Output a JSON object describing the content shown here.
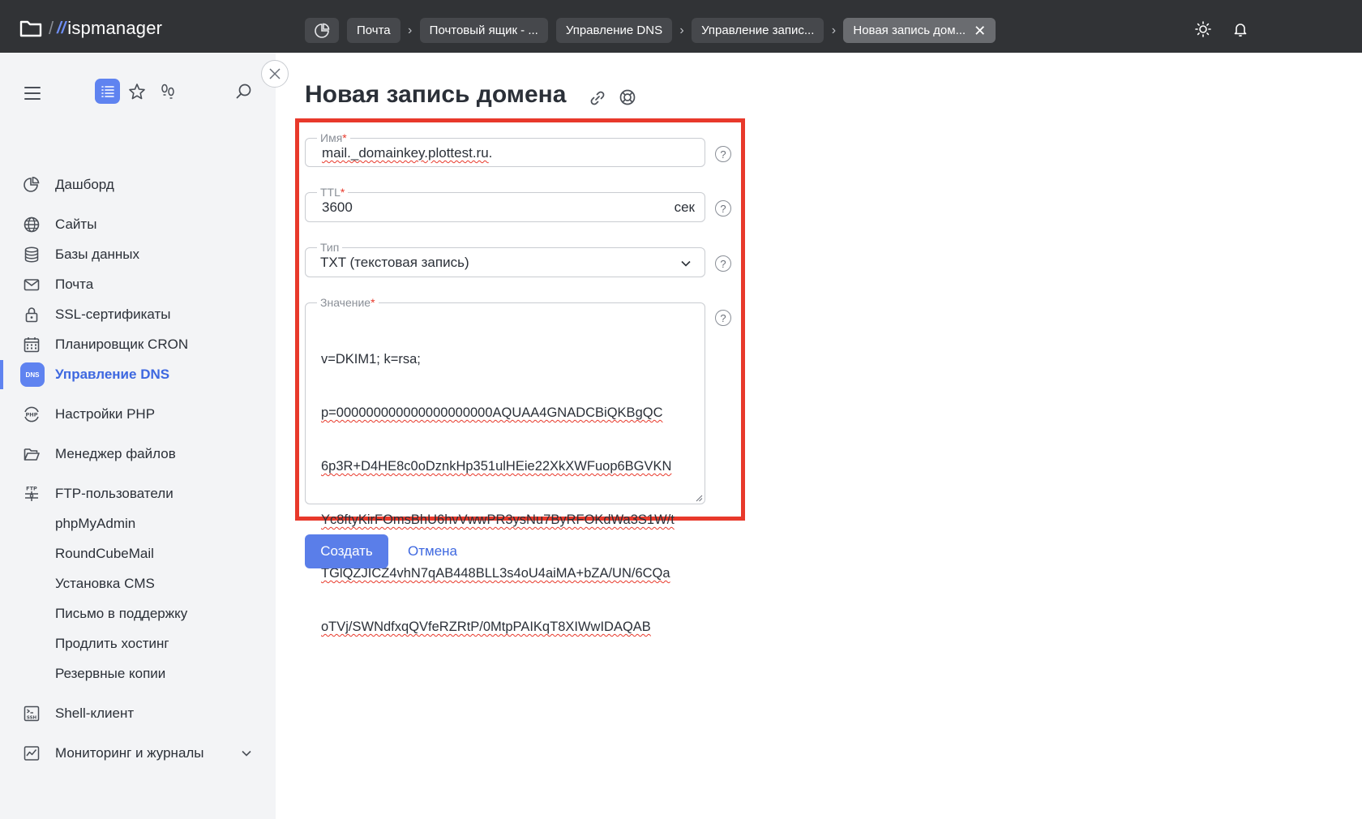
{
  "header": {
    "brand": "ispmanager",
    "breadcrumbs": [
      {
        "label": "Почта"
      },
      {
        "label": "Почтовый ящик - ..."
      },
      {
        "label": "Управление DNS"
      },
      {
        "label": "Управление запис..."
      },
      {
        "label": "Новая запись дом..."
      }
    ],
    "icons": [
      "dashboard-icon",
      "theme-sun-icon",
      "bell-icon",
      "close-icon"
    ]
  },
  "sidebar": {
    "items": [
      {
        "label": "Дашборд",
        "icon": "dashboard-icon"
      },
      {
        "label": "Сайты",
        "icon": "globe-icon"
      },
      {
        "label": "Базы данных",
        "icon": "database-icon"
      },
      {
        "label": "Почта",
        "icon": "mail-icon"
      },
      {
        "label": "SSL-сертификаты",
        "icon": "lock-icon"
      },
      {
        "label": "Планировщик CRON",
        "icon": "calendar-icon"
      },
      {
        "label": "Управление DNS",
        "icon": "dns-icon",
        "active": true,
        "badge": "DNS"
      },
      {
        "label": "Настройки PHP",
        "icon": "php-icon",
        "badge": "PHP"
      },
      {
        "label": "Менеджер файлов",
        "icon": "folder-icon"
      },
      {
        "label": "FTP-пользователи",
        "icon": "ftp-icon",
        "badge": "FTP"
      },
      {
        "label": "phpMyAdmin"
      },
      {
        "label": "RoundCubeMail"
      },
      {
        "label": "Установка CMS"
      },
      {
        "label": "Письмо в поддержку"
      },
      {
        "label": "Продлить хостинг"
      },
      {
        "label": "Резервные копии"
      },
      {
        "label": "Shell-клиент",
        "icon": "ssh-icon",
        "badge": "SSH"
      },
      {
        "label": "Мониторинг и журналы",
        "icon": "chart-icon"
      }
    ]
  },
  "main": {
    "title": "Новая запись домена",
    "fields": {
      "name": {
        "label": "Имя",
        "required": "*",
        "value": "mail._domainkey.plottest.ru",
        "suffix": "."
      },
      "ttl": {
        "label": "TTL",
        "required": "*",
        "value": "3600",
        "unit": "сек"
      },
      "type": {
        "label": "Тип",
        "value": "TXT (текстовая запись)"
      },
      "value": {
        "label": "Значение",
        "required": "*",
        "lines": [
          "v=DKIM1; k=rsa;",
          "p=000000000000000000000AQUAA4GNADCBiQKBgQC",
          "6p3R+D4HE8c0oDznkHp351ulHEie22XkXWFuop6BGVKN",
          "Yc8ftyKirFOmsBhU6hvVwwPR3ysNu7ByRFOKdWa3S1W/t",
          "TGlQZJICZ4vhN7qAB448BLL3s4oU4aiMA+bZA/UN/6CQa",
          "oTVj/SWNdfxqQVfeRZRtP/0MtpPAIKqT8XIWwIDAQAB"
        ]
      }
    },
    "help_glyph": "?",
    "buttons": {
      "create": "Создать",
      "cancel": "Отмена"
    },
    "colors": {
      "accent": "#5a7ee9",
      "highlight": "#e8392b",
      "topbar": "#313336"
    }
  }
}
